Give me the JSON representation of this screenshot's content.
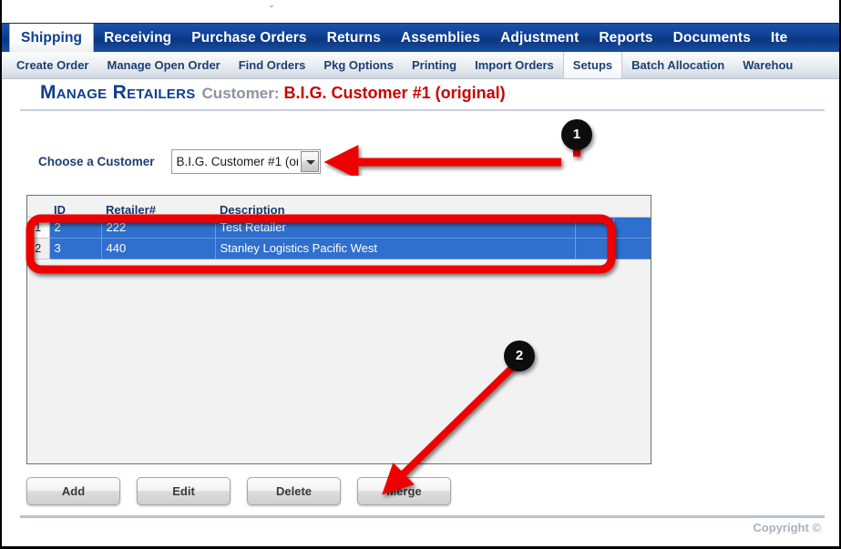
{
  "window": {
    "top_nub": "⌄"
  },
  "primary_tabs": [
    {
      "label": "Shipping",
      "active": true
    },
    {
      "label": "Receiving",
      "active": false
    },
    {
      "label": "Purchase Orders",
      "active": false
    },
    {
      "label": "Returns",
      "active": false
    },
    {
      "label": "Assemblies",
      "active": false
    },
    {
      "label": "Adjustment",
      "active": false
    },
    {
      "label": "Reports",
      "active": false
    },
    {
      "label": "Documents",
      "active": false
    },
    {
      "label": "Ite",
      "active": false
    }
  ],
  "secondary_tabs": [
    {
      "label": "Create Order",
      "active": false
    },
    {
      "label": "Manage Open Order",
      "active": false
    },
    {
      "label": "Find Orders",
      "active": false
    },
    {
      "label": "Pkg Options",
      "active": false
    },
    {
      "label": "Printing",
      "active": false
    },
    {
      "label": "Import Orders",
      "active": false
    },
    {
      "label": "Setups",
      "active": true
    },
    {
      "label": "Batch Allocation",
      "active": false
    },
    {
      "label": "Warehou",
      "active": false
    }
  ],
  "heading": {
    "title": "Manage Retailers",
    "customer_label": "Customer:",
    "customer_value": "B.I.G. Customer #1 (original)"
  },
  "chooser": {
    "label": "Choose a Customer",
    "selected": "B.I.G. Customer #1 (ori",
    "arrow_icon": "chevron-down-icon"
  },
  "grid": {
    "columns": [
      "",
      "ID",
      "Retailer#",
      "Description",
      "",
      ""
    ],
    "rows": [
      {
        "num": "1",
        "id": "2",
        "retailer": "222",
        "description": "Test Retailer",
        "x1": "",
        "x2": "",
        "current": true
      },
      {
        "num": "2",
        "id": "3",
        "retailer": "440",
        "description": "Stanley Logistics Pacific West",
        "x1": "",
        "x2": "",
        "current": false
      }
    ]
  },
  "buttons": [
    {
      "label": "Add"
    },
    {
      "label": "Edit"
    },
    {
      "label": "Delete"
    },
    {
      "label": "Merge"
    }
  ],
  "footer": {
    "copyright": "Copyright ©"
  },
  "annotations": {
    "callouts": [
      {
        "number": "1",
        "target": "customer-select-arrow"
      },
      {
        "number": "2",
        "target": "grid-selected-rows / merge-button"
      }
    ],
    "accent_color": "#ee0000",
    "badge_color": "#0d0d0d"
  },
  "colors": {
    "primary_tab_blue": "#0e3f92",
    "heading_blue": "#0f3f8c",
    "heading_red": "#cc0000",
    "row_select_blue": "#2f6fce",
    "annotation_red": "#ee0000"
  }
}
